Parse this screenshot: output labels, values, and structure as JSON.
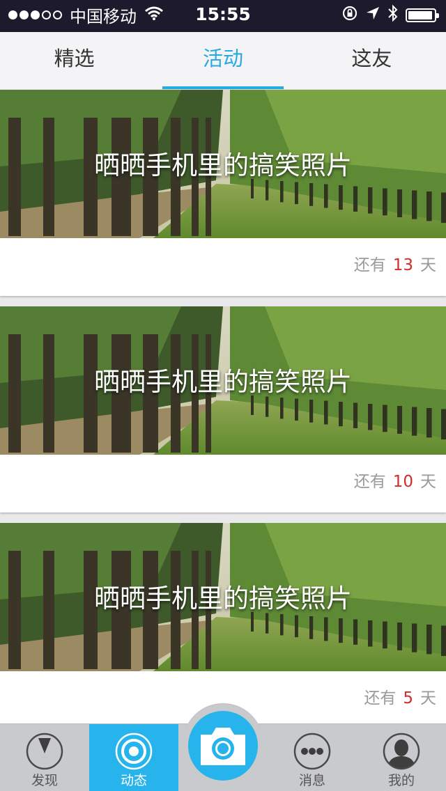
{
  "status_bar": {
    "carrier": "中国移动",
    "time": "15:55",
    "signal_icon": "signal-dots-icon",
    "wifi_icon": "wifi-icon",
    "lock_icon": "rotation-lock-icon",
    "location_icon": "location-arrow-icon",
    "bluetooth_icon": "bluetooth-icon",
    "battery_icon": "battery-icon",
    "battery_level": 0.95
  },
  "tabs": [
    {
      "label": "精选",
      "active": false
    },
    {
      "label": "活动",
      "active": true
    },
    {
      "label": "这友",
      "active": false
    }
  ],
  "cards": [
    {
      "title": "晒晒手机里的搞笑照片",
      "remain_prefix": "还有",
      "days": "13",
      "remain_suffix": "天",
      "image": "tree-lined-lawn-photo"
    },
    {
      "title": "晒晒手机里的搞笑照片",
      "remain_prefix": "还有",
      "days": "10",
      "remain_suffix": "天",
      "image": "tree-lined-lawn-photo"
    },
    {
      "title": "晒晒手机里的搞笑照片",
      "remain_prefix": "还有",
      "days": "5",
      "remain_suffix": "天",
      "image": "tree-lined-lawn-photo"
    }
  ],
  "bottom_nav": [
    {
      "label": "发现",
      "icon": "discover-icon",
      "active": false
    },
    {
      "label": "动态",
      "icon": "feed-radar-icon",
      "active": true
    },
    {
      "label": "",
      "icon": "camera-icon",
      "active": false
    },
    {
      "label": "消息",
      "icon": "message-dots-icon",
      "active": false
    },
    {
      "label": "我的",
      "icon": "profile-avatar-icon",
      "active": false
    }
  ],
  "colors": {
    "accent": "#27a9e3",
    "nav_active": "#27b3ec",
    "days_number": "#d22b2b",
    "status_bar_bg": "#1e1a2e"
  }
}
